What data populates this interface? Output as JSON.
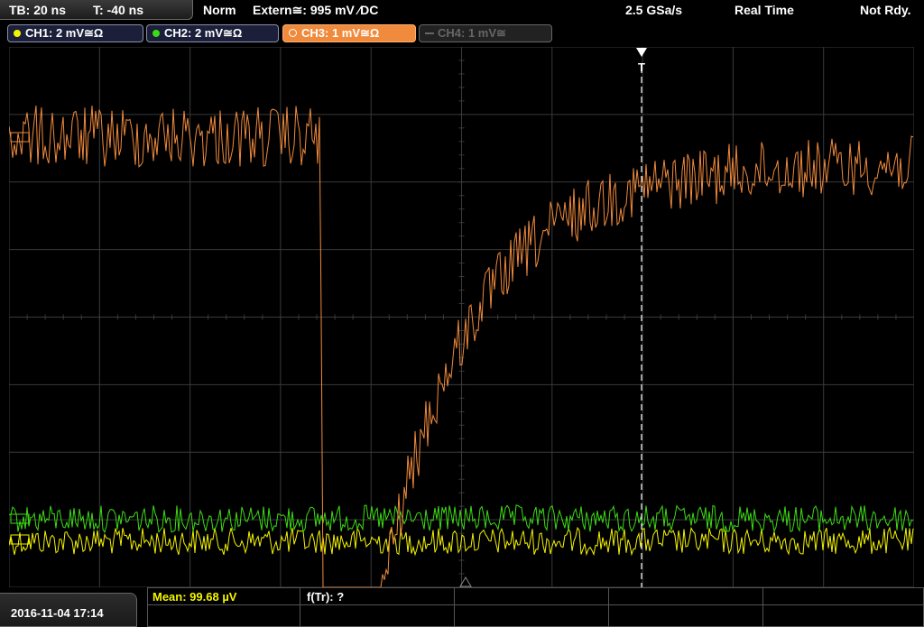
{
  "top": {
    "timebase": "TB: 20 ns",
    "trigger_time": "T: -40 ns",
    "trigger_mode": "Norm",
    "trigger_source": "Extern≅: 995 mV ⁄DC",
    "sample_rate": "2.5 GSa/s",
    "acq_mode": "Real Time",
    "status": "Not Rdy."
  },
  "channels": [
    {
      "label": "CH1: 2 mV≅Ω",
      "color": "#f4f400",
      "active": true
    },
    {
      "label": "CH2: 2 mV≅Ω",
      "color": "#3cdc14",
      "active": true
    },
    {
      "label": "CH3: 1 mV≅Ω",
      "color": "#f08a3c",
      "active": true,
      "selected": true
    },
    {
      "label": "CH4: 1 mV≅",
      "color": "#555555",
      "active": false
    }
  ],
  "bottom": {
    "datetime": "2016-11-04 17:14",
    "measurement_1": "Mean: 99.68 µV",
    "measurement_2": "f(Tr): ?"
  },
  "trigger_marker": "T",
  "colors": {
    "ch1": "#f4f400",
    "ch2": "#3cdc14",
    "ch3": "#f08a3c",
    "grid": "#3a3a3a",
    "trigger_line": "#ffffff"
  }
}
